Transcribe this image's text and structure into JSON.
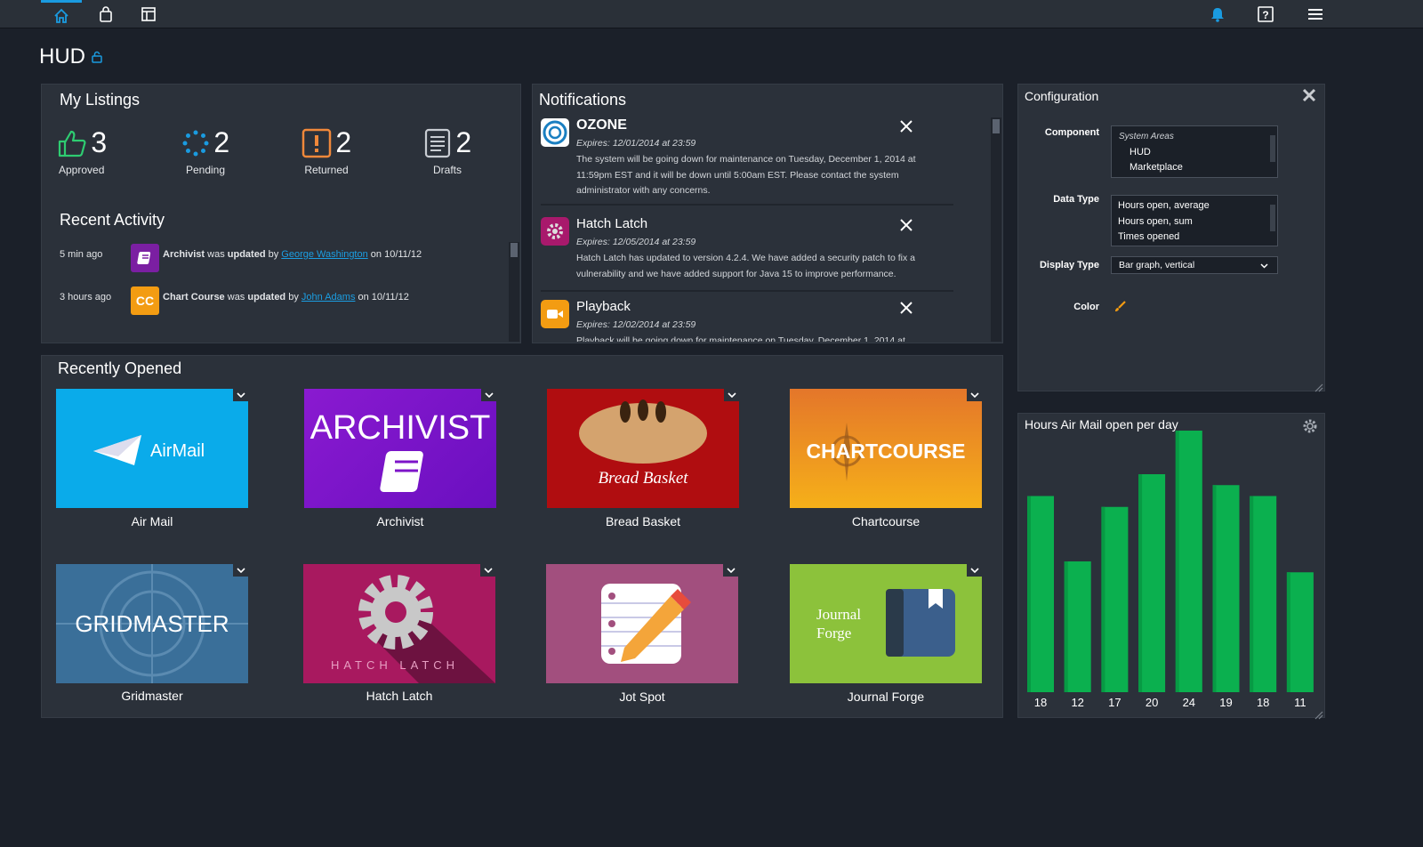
{
  "page": {
    "title": "HUD"
  },
  "nav": {
    "left_icons": [
      "home-icon",
      "bag-icon",
      "layout-icon"
    ],
    "right_icons": [
      "bell-icon",
      "help-icon",
      "menu-icon"
    ]
  },
  "listings": {
    "title": "My Listings",
    "stats": [
      {
        "count": "3",
        "label": "Approved",
        "icon": "thumbs-up-icon",
        "color": "#2ecc71"
      },
      {
        "count": "2",
        "label": "Pending",
        "icon": "pending-icon",
        "color": "#1a9be0"
      },
      {
        "count": "2",
        "label": "Returned",
        "icon": "warning-icon",
        "color": "#f0883a"
      },
      {
        "count": "2",
        "label": "Drafts",
        "icon": "document-icon",
        "color": "#c8ccd2"
      }
    ],
    "activity_title": "Recent Activity",
    "activity": [
      {
        "time": "5 min ago",
        "app": "Archivist",
        "verb1": "was",
        "action": "updated",
        "verb2": "by",
        "user": "George Washington",
        "on": "on 10/11/12"
      },
      {
        "time": "3 hours ago",
        "app": "Chart Course",
        "verb1": "was",
        "action": "updated",
        "verb2": "by",
        "user": "John Adams",
        "on": "on 10/11/12"
      }
    ]
  },
  "notifications": {
    "title": "Notifications",
    "items": [
      {
        "title": "OZONE",
        "expires": "Expires: 12/01/2014 at 23:59",
        "body": "The system will be going down for maintenance on Tuesday, December 1, 2014 at 11:59pm EST and it will be down until 5:00am EST. Please contact the system administrator with any concerns."
      },
      {
        "title": "Hatch Latch",
        "expires": "Expires: 12/05/2014 at 23:59",
        "body": "Hatch Latch has updated to version 4.2.4. We have added a security patch to fix a vulnerability and we have added support for Java 15 to improve performance."
      },
      {
        "title": "Playback",
        "expires": "Expires: 12/02/2014 at 23:59",
        "body": "Playback will be going down for maintenance on Tuesday, December 1, 2014 at"
      }
    ]
  },
  "recent": {
    "title": "Recently Opened",
    "tiles": [
      {
        "label": "Air Mail",
        "art": "AirMail"
      },
      {
        "label": "Archivist",
        "art": "ARCHIVIST"
      },
      {
        "label": "Bread Basket",
        "art": "Bread Basket"
      },
      {
        "label": "Chartcourse",
        "art": "CHARTCOURSE"
      },
      {
        "label": "Gridmaster",
        "art": "GRIDMASTER"
      },
      {
        "label": "Hatch Latch",
        "art": "HATCH LATCH"
      },
      {
        "label": "Jot Spot",
        "art": ""
      },
      {
        "label": "Journal Forge",
        "art": "Journal Forge"
      }
    ]
  },
  "config": {
    "title": "Configuration",
    "component_label": "Component",
    "component_options": {
      "group": "System Areas",
      "items": [
        "HUD",
        "Marketplace"
      ]
    },
    "datatype_label": "Data Type",
    "datatype_options": [
      "Hours open, average",
      "Hours open, sum",
      "Times opened"
    ],
    "display_label": "Display Type",
    "display_value": "Bar graph, vertical",
    "color_label": "Color"
  },
  "chart_data": {
    "type": "bar",
    "title": "Hours Air Mail open per day",
    "categories": [
      "18",
      "12",
      "17",
      "20",
      "24",
      "19",
      "18",
      "11"
    ],
    "values": [
      18,
      12,
      17,
      20,
      24,
      19,
      18,
      11
    ],
    "ylim": [
      0,
      24
    ],
    "color": "#0bb04f"
  }
}
